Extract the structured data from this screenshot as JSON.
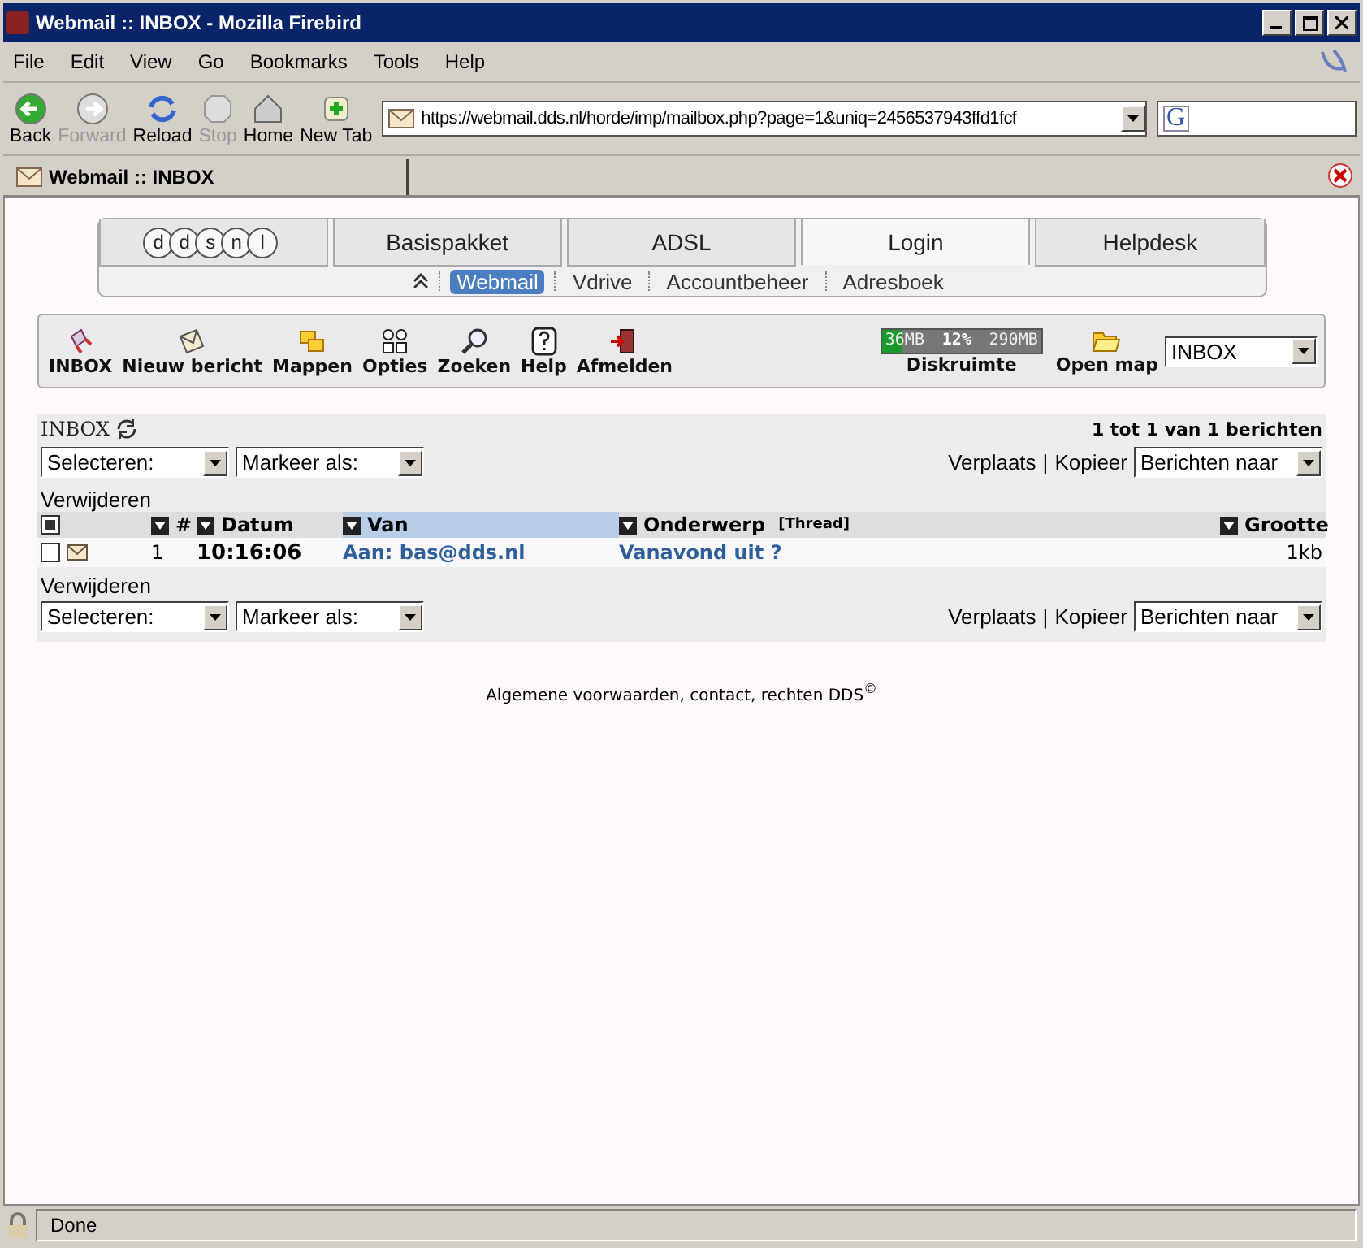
{
  "window": {
    "title": "Webmail :: INBOX - Mozilla Firebird"
  },
  "menu": [
    "File",
    "Edit",
    "View",
    "Go",
    "Bookmarks",
    "Tools",
    "Help"
  ],
  "nav_buttons": [
    {
      "label": "Back",
      "disabled": false
    },
    {
      "label": "Forward",
      "disabled": true
    },
    {
      "label": "Reload",
      "disabled": false
    },
    {
      "label": "Stop",
      "disabled": true
    },
    {
      "label": "Home",
      "disabled": false
    },
    {
      "label": "New Tab",
      "disabled": false
    }
  ],
  "address": {
    "value": "https://webmail.dds.nl/horde/imp/mailbox.php?page=1&uniq=2456537943ffd1fcf"
  },
  "search": {
    "value": "G"
  },
  "tabs": [
    {
      "label": "Webmail :: INBOX",
      "selected": true
    }
  ],
  "site_tabs": [
    {
      "label": "Basispakket",
      "selected": false
    },
    {
      "label": "ADSL",
      "selected": false
    },
    {
      "label": "Login",
      "selected": true
    },
    {
      "label": "Helpdesk",
      "selected": false
    }
  ],
  "logo": {
    "letters": [
      "d",
      "d",
      "s",
      "n",
      "l"
    ]
  },
  "subnav": [
    {
      "label": "Webmail",
      "selected": true
    },
    {
      "label": "Vdrive",
      "selected": false
    },
    {
      "label": "Accountbeheer",
      "selected": false
    },
    {
      "label": "Adresboek",
      "selected": false
    }
  ],
  "toolbar": [
    "INBOX",
    "Nieuw bericht",
    "Mappen",
    "Opties",
    "Zoeken",
    "Help",
    "Afmelden"
  ],
  "quota": {
    "used": "36MB",
    "percent": "12%",
    "total": "290MB",
    "level": 0.12,
    "label": "Diskruimte"
  },
  "open_map": "Open map",
  "folder_select": "INBOX",
  "mailbox": {
    "title": "INBOX",
    "count": "1 tot 1 van 1 berichten",
    "control_bars": [
      {
        "select": "Selecteren:",
        "mark": "Markeer als:",
        "move": "Verplaats",
        "separator": "|",
        "copy": "Kopieer",
        "target": "Berichten naar",
        "delete": "Verwijderen"
      },
      {
        "delete": "Verwijderen",
        "select": "Selecteren:",
        "mark": "Markeer als:",
        "move": "Verplaats",
        "separator": "|",
        "copy": "Kopieer",
        "target": "Berichten naar"
      }
    ],
    "columns": [
      {
        "label": "#",
        "sorted": false
      },
      {
        "label": "Datum",
        "sorted": false
      },
      {
        "label": "Van",
        "sorted": true
      },
      {
        "label": "Onderwerp",
        "sorted": false,
        "extra": "[Thread]"
      },
      {
        "label": "Grootte",
        "sorted": false
      }
    ],
    "header_checked": true,
    "rows": [
      {
        "checked": false,
        "num": "1",
        "date": "10:16:06",
        "from": "Aan: bas@dds.nl",
        "subject": "Vanavond uit ?",
        "size": "1kb"
      }
    ]
  },
  "footer": "Algemene voorwaarden, contact, rechten DDS$^{©}$",
  "status_bar": {
    "text": "Done"
  }
}
